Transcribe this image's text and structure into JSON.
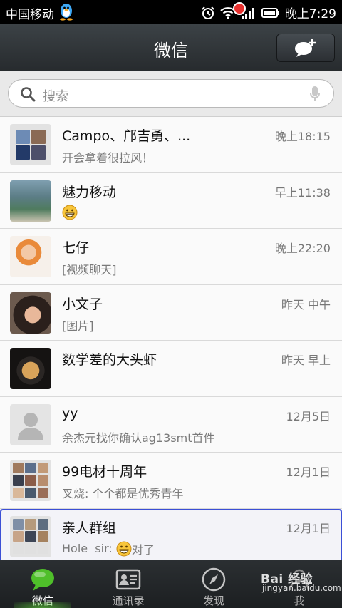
{
  "status_bar": {
    "carrier": "中国移动",
    "time": "晚上7:29"
  },
  "header": {
    "title": "微信",
    "compose_icon": "new-chat-bubble-plus-icon"
  },
  "search": {
    "placeholder": "搜索",
    "icons": [
      "search-icon",
      "microphone-icon"
    ]
  },
  "chats": [
    {
      "name": "Campo、邝吉勇、...",
      "time": "晚上18:15",
      "message": "开会拿着很拉风！"
    },
    {
      "name": "魅力移动",
      "time": "早上11:38",
      "message": "",
      "emoji": "grin-smiley"
    },
    {
      "name": "七仔",
      "time": "晚上22:20",
      "message": "[视频聊天]"
    },
    {
      "name": "小文子",
      "time": "昨天 中午",
      "message": "[图片]"
    },
    {
      "name": "数学差的大头虾",
      "time": "昨天 早上",
      "message": ""
    },
    {
      "name": "yy",
      "time": "12月5日",
      "message": "余杰元找你确认ag13smt首件"
    },
    {
      "name": "99电材十周年",
      "time": "12月1日",
      "message": "叉烧: 个个都是优秀青年"
    },
    {
      "name": "亲人群组",
      "time": "12月1日",
      "message_prefix": "Hole  sir: ",
      "message": "对了",
      "emoji": "grin-smiley"
    }
  ],
  "tabs": [
    {
      "label": "微信",
      "icon": "chat-bubble-icon",
      "active": true
    },
    {
      "label": "通讯录",
      "icon": "contacts-card-icon",
      "active": false
    },
    {
      "label": "发现",
      "icon": "compass-icon",
      "active": false,
      "badge": true
    },
    {
      "label": "我",
      "icon": "person-icon",
      "active": false
    }
  ],
  "watermark": {
    "line1": "Bai 经验",
    "line2": "jingyan.baidu.com"
  },
  "colors": {
    "accent_green": "#4fbf2a",
    "selection_border": "#3b4fd6",
    "badge_red": "#e8312f"
  }
}
